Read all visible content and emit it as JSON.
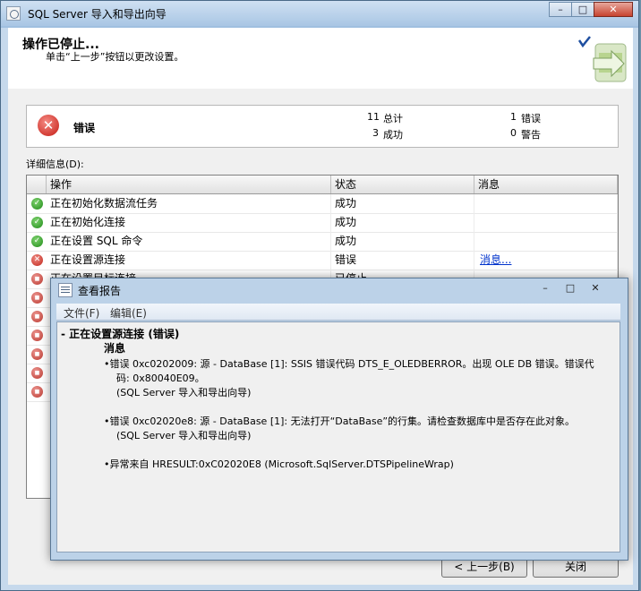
{
  "window": {
    "title": "SQL Server 导入和导出向导",
    "minimize": "–",
    "maximize": "□",
    "close": "✕"
  },
  "header": {
    "title": "操作已停止...",
    "subtitle": "单击“上一步”按钮以更改设置。"
  },
  "summary": {
    "status_label": "错误",
    "total_count": "11",
    "total_label": "总计",
    "success_count": "3",
    "success_label": "成功",
    "error_count": "1",
    "error_label": "错误",
    "warning_count": "0",
    "warning_label": "警告"
  },
  "details_label": "详细信息(D):",
  "grid": {
    "columns": [
      "操作",
      "状态",
      "消息"
    ],
    "rows": [
      {
        "status_icon": "success-icon",
        "action": "正在初始化数据流任务",
        "status": "成功",
        "message": ""
      },
      {
        "status_icon": "success-icon",
        "action": "正在初始化连接",
        "status": "成功",
        "message": ""
      },
      {
        "status_icon": "success-icon",
        "action": "正在设置 SQL 命令",
        "status": "成功",
        "message": ""
      },
      {
        "status_icon": "error-icon",
        "action": "正在设置源连接",
        "status": "错误",
        "message": "消息..."
      },
      {
        "status_icon": "stopped-icon",
        "action": "正在设置目标连接",
        "status": "已停止",
        "message": ""
      },
      {
        "status_icon": "stopped-icon",
        "action": "",
        "status": "",
        "message": ""
      },
      {
        "status_icon": "stopped-icon",
        "action": "",
        "status": "",
        "message": ""
      },
      {
        "status_icon": "stopped-icon",
        "action": "",
        "status": "",
        "message": ""
      },
      {
        "status_icon": "stopped-icon",
        "action": "",
        "status": "",
        "message": ""
      },
      {
        "status_icon": "stopped-icon",
        "action": "",
        "status": "",
        "message": ""
      },
      {
        "status_icon": "stopped-icon",
        "action": "",
        "status": "",
        "message": ""
      }
    ]
  },
  "buttons": {
    "back": "< 上一步(B)",
    "close": "关闭"
  },
  "report": {
    "title": "查看报告",
    "menu_file": "文件(F)",
    "menu_edit": "编辑(E)",
    "section": "- 正在设置源连接 (错误)",
    "subsection": "消息",
    "line1a": "•错误 0xc0202009: 源 - DataBase [1]: SSIS 错误代码 DTS_E_OLEDBERROR。出现 OLE DB 错误。错误代",
    "line1b": "码: 0x80040E09。",
    "line1c": "(SQL Server 导入和导出向导)",
    "line2a": "•错误 0xc02020e8: 源 - DataBase [1]: 无法打开“DataBase”的行集。请检查数据库中是否存在此对象。",
    "line2b": "(SQL Server 导入和导出向导)",
    "line3": "•异常来自 HRESULT:0xC02020E8 (Microsoft.SqlServer.DTSPipelineWrap)"
  }
}
